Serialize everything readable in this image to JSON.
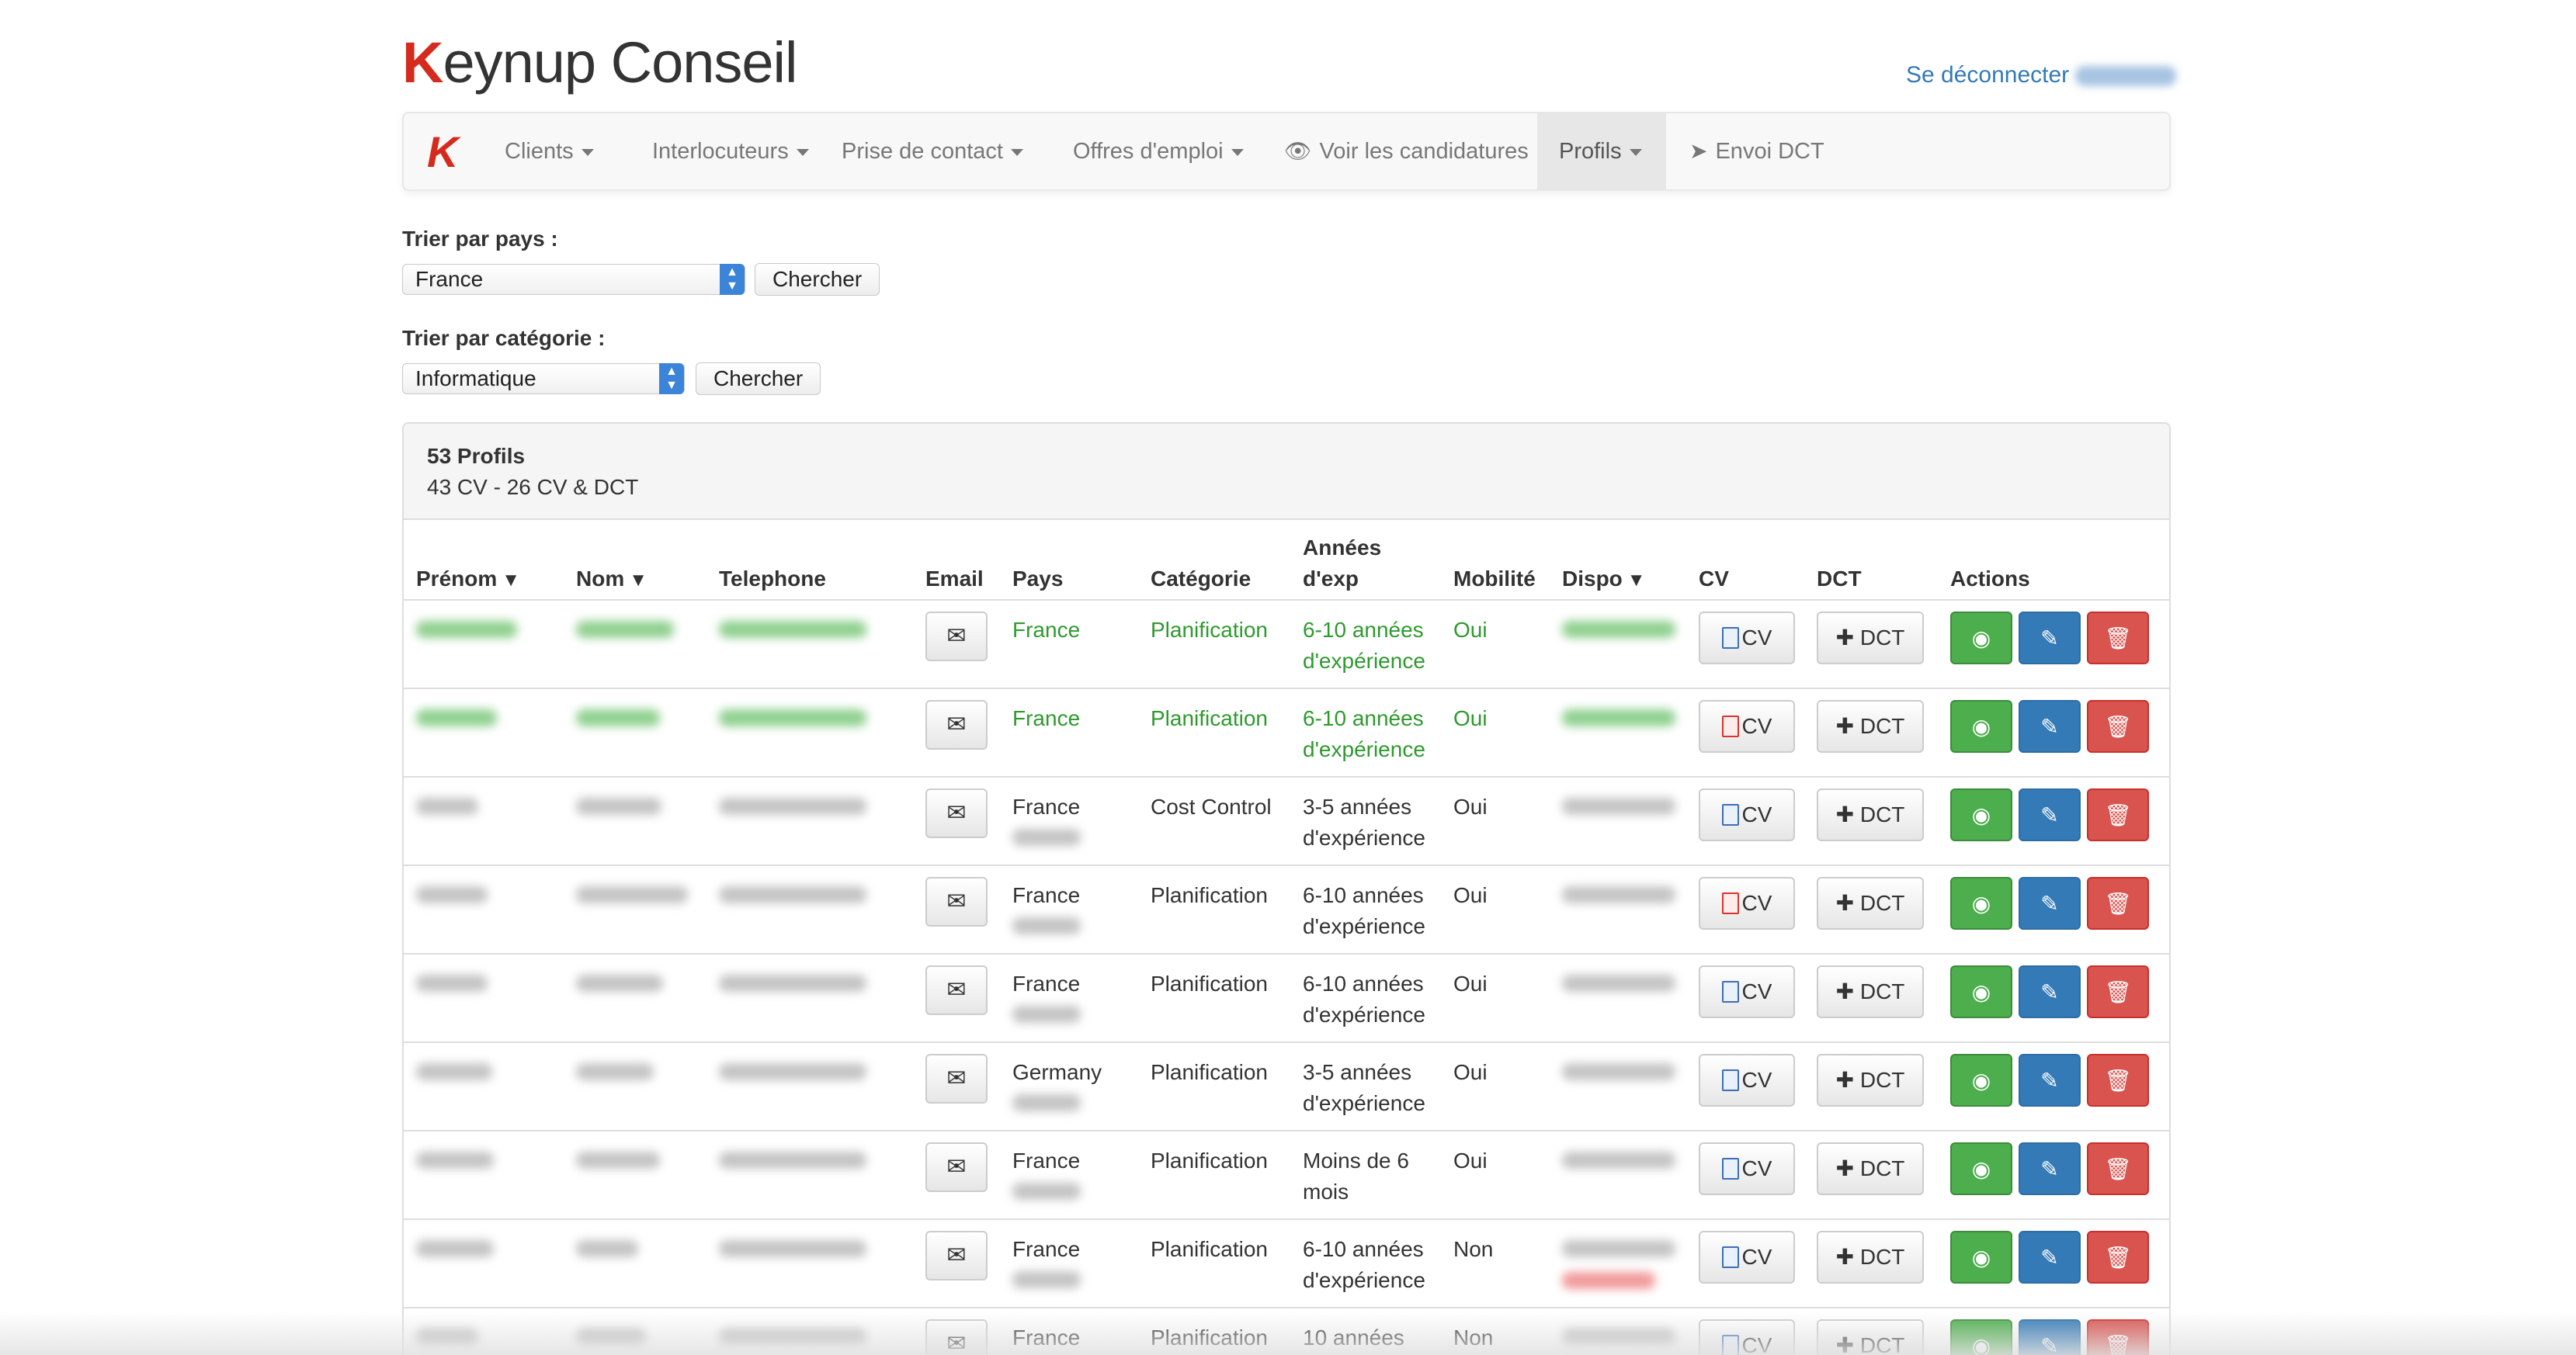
{
  "header": {
    "brand_k": "K",
    "brand_rest": "eynup Conseil",
    "logout_label": "Se déconnecter"
  },
  "nav": {
    "logo": "K",
    "items": [
      {
        "label": "Clients",
        "dropdown": true
      },
      {
        "label": "Interlocuteurs",
        "dropdown": true
      },
      {
        "label": "Prise de contact",
        "dropdown": true
      },
      {
        "label": "Offres d'emploi",
        "dropdown": true
      },
      {
        "label": "Voir les candidatures",
        "icon": "eye-icon"
      },
      {
        "label": "Profils",
        "dropdown": true,
        "active": true
      },
      {
        "label": "Envoi DCT",
        "icon": "paper-plane-icon"
      }
    ]
  },
  "filters": {
    "country": {
      "label": "Trier par pays :",
      "selected": "France",
      "button": "Chercher"
    },
    "category": {
      "label": "Trier par catégorie :",
      "selected": "Informatique",
      "button": "Chercher"
    }
  },
  "panel": {
    "count": "53 Profils",
    "subtitle": "43 CV - 26 CV & DCT"
  },
  "table": {
    "headers": {
      "prenom": "Prénom",
      "nom": "Nom",
      "telephone": "Telephone",
      "email": "Email",
      "pays": "Pays",
      "categorie": "Catégorie",
      "annees_1": "Années",
      "annees_2": "d'exp",
      "mobilite": "Mobilité",
      "dispo": "Dispo",
      "cv": "CV",
      "dct": "DCT",
      "actions": "Actions"
    },
    "button_labels": {
      "cv": "CV",
      "dct": "DCT"
    },
    "rows": [
      {
        "pays": "France",
        "categorie": "Planification",
        "exp_1": "6-10 années",
        "exp_2": "d'expérience",
        "mobilite": "Oui",
        "cv_type": "doc",
        "highlight": true
      },
      {
        "pays": "France",
        "categorie": "Planification",
        "exp_1": "6-10 années",
        "exp_2": "d'expérience",
        "mobilite": "Oui",
        "cv_type": "pdf",
        "highlight": true
      },
      {
        "pays": "France",
        "categorie": "Cost Control",
        "exp_1": "3-5 années",
        "exp_2": "d'expérience",
        "mobilite": "Oui",
        "cv_type": "doc",
        "highlight": false
      },
      {
        "pays": "France",
        "categorie": "Planification",
        "exp_1": "6-10 années",
        "exp_2": "d'expérience",
        "mobilite": "Oui",
        "cv_type": "pdf",
        "highlight": false
      },
      {
        "pays": "France",
        "categorie": "Planification",
        "exp_1": "6-10 années",
        "exp_2": "d'expérience",
        "mobilite": "Oui",
        "cv_type": "doc",
        "highlight": false
      },
      {
        "pays": "Germany",
        "categorie": "Planification",
        "exp_1": "3-5 années",
        "exp_2": "d'expérience",
        "mobilite": "Oui",
        "cv_type": "doc",
        "highlight": false
      },
      {
        "pays": "France",
        "categorie": "Planification",
        "exp_1": "Moins de 6",
        "exp_2": "mois",
        "mobilite": "Oui",
        "cv_type": "doc",
        "highlight": false
      },
      {
        "pays": "France",
        "categorie": "Planification",
        "exp_1": "6-10 années",
        "exp_2": "d'expérience",
        "mobilite": "Non",
        "cv_type": "doc",
        "highlight": false
      },
      {
        "pays": "France",
        "categorie": "Planification",
        "exp_1": "10 années",
        "exp_2": "",
        "mobilite": "Non",
        "cv_type": "doc",
        "highlight": false
      }
    ]
  },
  "colors": {
    "brand_red": "#d52b1e",
    "link_blue": "#337ab7",
    "highlight_green": "#2e9a2e",
    "view_button": "#4cae4c",
    "edit_button": "#337ab7",
    "delete_button": "#d9534f"
  }
}
